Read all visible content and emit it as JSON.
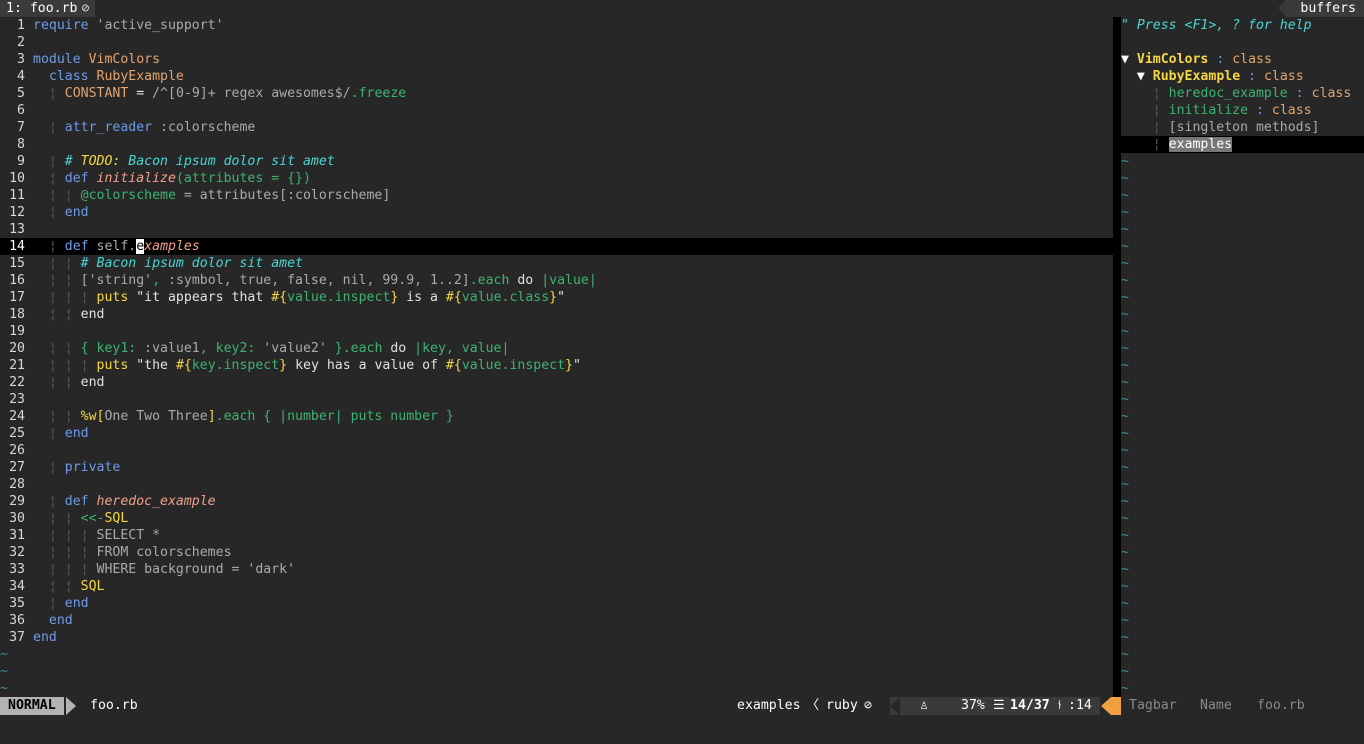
{
  "tabline": {
    "tab_label": "1: foo.rb",
    "tab_icon": "lock-icon",
    "buffers_label": "buffers"
  },
  "editor": {
    "lines": [
      {
        "n": "1"
      },
      {
        "n": "2"
      },
      {
        "n": "3"
      },
      {
        "n": "4"
      },
      {
        "n": "5"
      },
      {
        "n": "6"
      },
      {
        "n": "7"
      },
      {
        "n": "8"
      },
      {
        "n": "9"
      },
      {
        "n": "10"
      },
      {
        "n": "11"
      },
      {
        "n": "12"
      },
      {
        "n": "13"
      },
      {
        "n": "14"
      },
      {
        "n": "15"
      },
      {
        "n": "16"
      },
      {
        "n": "17"
      },
      {
        "n": "18"
      },
      {
        "n": "19"
      },
      {
        "n": "20"
      },
      {
        "n": "21"
      },
      {
        "n": "22"
      },
      {
        "n": "23"
      },
      {
        "n": "24"
      },
      {
        "n": "25"
      },
      {
        "n": "26"
      },
      {
        "n": "27"
      },
      {
        "n": "28"
      },
      {
        "n": "29"
      },
      {
        "n": "30"
      },
      {
        "n": "31"
      },
      {
        "n": "32"
      },
      {
        "n": "33"
      },
      {
        "n": "34"
      },
      {
        "n": "35"
      },
      {
        "n": "36"
      },
      {
        "n": "37"
      }
    ],
    "code": {
      "l1_kw": "require",
      "l1_str": " 'active_support'",
      "l3_kw": "module",
      "l3_const": " VimColors",
      "l4_kw": "  class",
      "l4_const": " RubyExample",
      "l5_const": "CONSTANT",
      "l5_a": " = ",
      "l5_b": "/^[0-9]+ regex awesomes$/",
      "l5_c": ".freeze",
      "l7_kw": "attr_reader",
      "l7_sym": " :colorscheme",
      "l9_hash": "# ",
      "l9_todo": "TODO:",
      "l9_txt": " Bacon ipsum dolor sit amet",
      "l10_def": "def",
      "l10_fn": " initialize",
      "l10_args": "(attributes = {})",
      "l11_ivar": "@colorscheme",
      "l11_rest": " = attributes[:colorscheme]",
      "l12_end": "end",
      "l14_def": "def",
      "l14_self": " self.",
      "l14_cur": "e",
      "l14_fn": "xamples",
      "l15_cmt": "# Bacon ipsum dolor sit amet",
      "l16_a": "['string'",
      "l16_b": ", ",
      "l16_c": ":symbol",
      "l16_d": ", true, false, nil, 99.9, 1..2]",
      "l16_e": ".each",
      "l16_do": " do",
      "l16_f": " |value|",
      "l17_puts": "puts",
      "l17_s1": " \"it appears that ",
      "l17_i1o": "#{",
      "l17_i1": "value.inspect",
      "l17_i1c": "}",
      "l17_s2": " is a ",
      "l17_i2o": "#{",
      "l17_i2": "value.class",
      "l17_i2c": "}",
      "l17_s3": "\"",
      "l18_end": "end",
      "l20_a": "{ key1: ",
      "l20_b": ":value1",
      "l20_c": ", key2: ",
      "l20_d": "'value2'",
      "l20_e": " }.each",
      "l20_do": " do",
      "l20_f": " |key, value|",
      "l21_puts": "puts",
      "l21_s1": " \"the ",
      "l21_i1o": "#{",
      "l21_i1": "key.inspect",
      "l21_i1c": "}",
      "l21_s2": " key has a value of ",
      "l21_i2o": "#{",
      "l21_i2": "value.inspect",
      "l21_i2c": "}",
      "l21_s3": "\"",
      "l22_end": "end",
      "l24_a": "%w[",
      "l24_b": "One Two Three",
      "l24_c": "]",
      "l24_d": ".each { |number| puts number }",
      "l25_end": "end",
      "l27_kw": "private",
      "l29_def": "def",
      "l29_fn": " heredoc_example",
      "l30_a": "<<-",
      "l30_b": "SQL",
      "l31": "SELECT *",
      "l32": "FROM colorschemes",
      "l33": "WHERE background = 'dark'",
      "l34": "SQL",
      "l35_end": "end",
      "l36_end": "end",
      "l37_end": "end"
    },
    "tilde": "~"
  },
  "tagbar": {
    "help": "\" Press <F1>, ? for help",
    "tree": {
      "root_name": "VimColors",
      "root_kind": "class",
      "child_name": "RubyExample",
      "child_kind": "class",
      "m1_name": "heredoc_example",
      "m1_kind": "class",
      "m2_name": "initialize",
      "m2_kind": "class",
      "singleton": "[singleton methods]",
      "selected": "examples"
    },
    "colon": " : ",
    "triangle": "▼"
  },
  "statusline": {
    "mode": "NORMAL",
    "filename": "foo.rb",
    "current_tag": "examples",
    "separator": "〈",
    "filetype": "ruby",
    "filetype_icon": "lock-icon",
    "os_icon": "linux-icon",
    "percent": "37%",
    "lines_icon": "☰",
    "line_pos": "14/37",
    "col_icon": "㏑",
    "col_pos": ":14",
    "tagbar_name": "Tagbar",
    "tagbar_sort": "Name",
    "tagbar_file": "foo.rb"
  },
  "colors": {
    "background": "#272727",
    "keyword": "#6f9ae8",
    "constant": "#e3a46e",
    "green": "#3cb371",
    "comment": "#47d5d5",
    "todo": "#f5d742",
    "tilde": "#3e8d9a",
    "warning": "#f0a040"
  }
}
